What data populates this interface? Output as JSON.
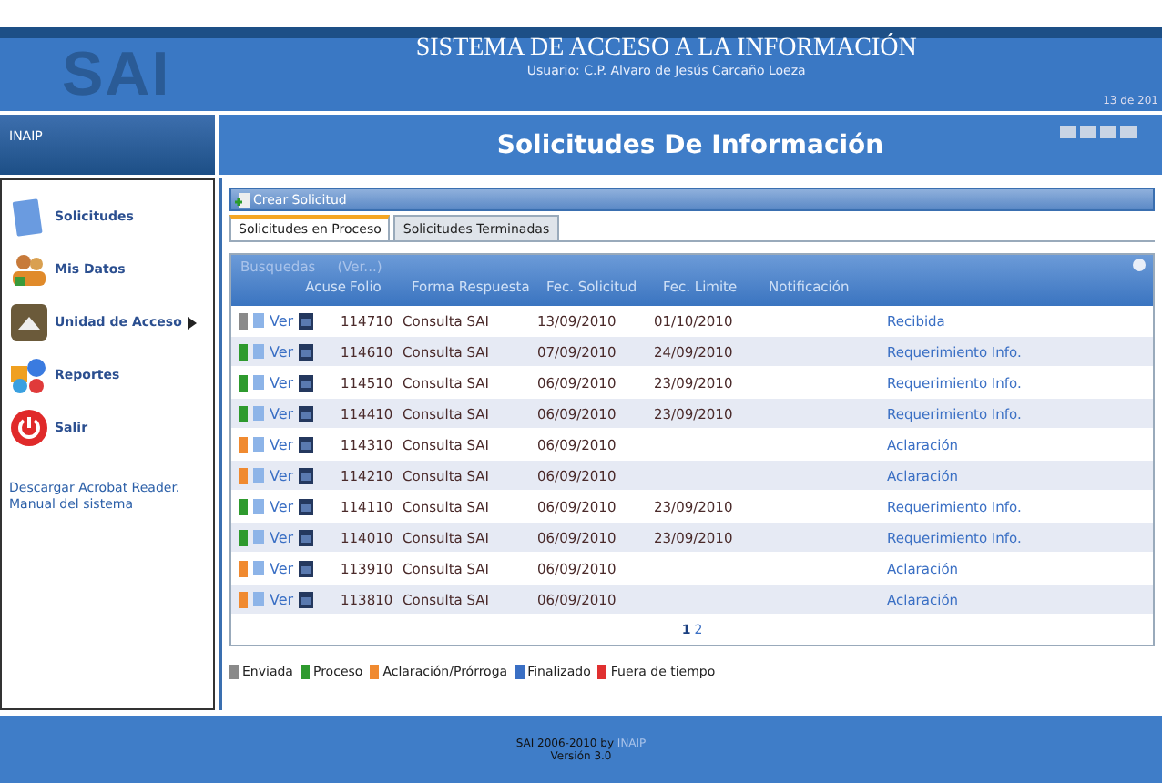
{
  "header": {
    "logo": "SAI",
    "title": "SISTEMA DE ACCESO A LA INFORMACIÓN",
    "user": "Usuario: C.P. Alvaro de Jesús Carcaño Loeza",
    "date": "13 de 201"
  },
  "org_label": "INAIP",
  "page_title": "Solicitudes De Información",
  "sidebar": {
    "items": [
      {
        "label": "Solicitudes",
        "kind": "doc",
        "submenu": false
      },
      {
        "label": "Mis Datos",
        "kind": "people",
        "submenu": false
      },
      {
        "label": "Unidad de Acceso",
        "kind": "building",
        "submenu": true
      },
      {
        "label": "Reportes",
        "kind": "chart",
        "submenu": false
      },
      {
        "label": "Salir",
        "kind": "power",
        "submenu": false
      }
    ],
    "links": [
      "Descargar Acrobat Reader.",
      "Manual del sistema"
    ]
  },
  "toolbar": {
    "button": "Crear Solicitud"
  },
  "tabs": [
    {
      "label": "Solicitudes en Proceso",
      "selected": true
    },
    {
      "label": "Solicitudes Terminadas",
      "selected": false
    }
  ],
  "grid": {
    "search": "Busquedas",
    "search_link": "(Ver...)",
    "columns": [
      "Acuse",
      "Folio",
      "Forma Respuesta",
      "Fec. Solicitud",
      "Fec. Limite",
      "Notificación"
    ],
    "rows": [
      {
        "color": "#8a8a8a",
        "view": "Ver",
        "folio": "114710",
        "forma": "Consulta SAI",
        "fec_solicitud": "13/09/2010",
        "fec_limite": "01/10/2010",
        "column_7": "Recibida"
      },
      {
        "color": "#2e9a2e",
        "view": "Ver",
        "folio": "114610",
        "forma": "Consulta SAI",
        "fec_solicitud": "07/09/2010",
        "fec_limite": "24/09/2010",
        "column_7": "Requerimiento Info."
      },
      {
        "color": "#2e9a2e",
        "view": "Ver",
        "folio": "114510",
        "forma": "Consulta SAI",
        "fec_solicitud": "06/09/2010",
        "fec_limite": "23/09/2010",
        "column_7": "Requerimiento Info."
      },
      {
        "color": "#2e9a2e",
        "view": "Ver",
        "folio": "114410",
        "forma": "Consulta SAI",
        "fec_solicitud": "06/09/2010",
        "fec_limite": "23/09/2010",
        "column_7": "Requerimiento Info."
      },
      {
        "color": "#f08a30",
        "view": "Ver",
        "folio": "114310",
        "forma": "Consulta SAI",
        "fec_solicitud": "06/09/2010",
        "column_7": "Aclaración"
      },
      {
        "color": "#f08a30",
        "view": "Ver",
        "folio": "114210",
        "forma": "Consulta SAI",
        "fec_solicitud": "06/09/2010",
        "column_7": "Aclaración"
      },
      {
        "color": "#2e9a2e",
        "view": "Ver",
        "folio": "114110",
        "forma": "Consulta SAI",
        "fec_solicitud": "06/09/2010",
        "fec_limite": "23/09/2010",
        "column_7": "Requerimiento Info."
      },
      {
        "color": "#2e9a2e",
        "view": "Ver",
        "folio": "114010",
        "forma": "Consulta SAI",
        "fec_solicitud": "06/09/2010",
        "fec_limite": "23/09/2010",
        "column_7": "Requerimiento Info."
      },
      {
        "color": "#f08a30",
        "view": "Ver",
        "folio": "113910",
        "forma": "Consulta SAI",
        "fec_solicitud": "06/09/2010",
        "column_7": "Aclaración"
      },
      {
        "color": "#f08a30",
        "view": "Ver",
        "folio": "113810",
        "forma": "Consulta SAI",
        "fec_solicitud": "06/09/2010",
        "column_7": "Aclaración"
      }
    ],
    "pages": [
      {
        "label": "1",
        "selected": true
      },
      {
        "label": "2",
        "selected": false
      }
    ]
  },
  "legend": [
    {
      "label": "Enviada",
      "color": "#8a8a8a"
    },
    {
      "label": "Proceso",
      "color": "#2e9a2e"
    },
    {
      "label": "Aclaración/Prórroga",
      "color": "#f08a30"
    },
    {
      "label": "Finalizado",
      "color": "#3a6fc4"
    },
    {
      "label": "Fuera de tiempo",
      "color": "#e03030"
    }
  ],
  "footer": {
    "line1": "SAI 2006-2010 by",
    "link": "INAIP",
    "line2": "Versión 3.0"
  }
}
